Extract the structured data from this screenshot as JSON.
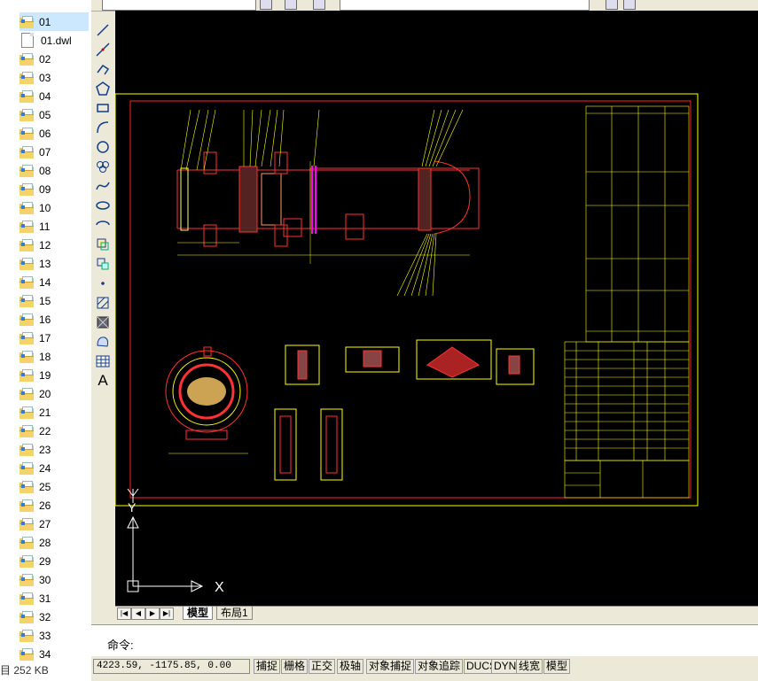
{
  "explorer": {
    "items": [
      {
        "label": "01",
        "type": "folder",
        "selected": true
      },
      {
        "label": "01.dwl",
        "type": "file"
      },
      {
        "label": "02",
        "type": "folder"
      },
      {
        "label": "03",
        "type": "folder"
      },
      {
        "label": "04",
        "type": "folder"
      },
      {
        "label": "05",
        "type": "folder"
      },
      {
        "label": "06",
        "type": "folder"
      },
      {
        "label": "07",
        "type": "folder"
      },
      {
        "label": "08",
        "type": "folder"
      },
      {
        "label": "09",
        "type": "folder"
      },
      {
        "label": "10",
        "type": "folder"
      },
      {
        "label": "11",
        "type": "folder"
      },
      {
        "label": "12",
        "type": "folder"
      },
      {
        "label": "13",
        "type": "folder"
      },
      {
        "label": "14",
        "type": "folder"
      },
      {
        "label": "15",
        "type": "folder"
      },
      {
        "label": "16",
        "type": "folder"
      },
      {
        "label": "17",
        "type": "folder"
      },
      {
        "label": "18",
        "type": "folder"
      },
      {
        "label": "19",
        "type": "folder"
      },
      {
        "label": "20",
        "type": "folder"
      },
      {
        "label": "21",
        "type": "folder"
      },
      {
        "label": "22",
        "type": "folder"
      },
      {
        "label": "23",
        "type": "folder"
      },
      {
        "label": "24",
        "type": "folder"
      },
      {
        "label": "25",
        "type": "folder"
      },
      {
        "label": "26",
        "type": "folder"
      },
      {
        "label": "27",
        "type": "folder"
      },
      {
        "label": "28",
        "type": "folder"
      },
      {
        "label": "29",
        "type": "folder"
      },
      {
        "label": "30",
        "type": "folder"
      },
      {
        "label": "31",
        "type": "folder"
      },
      {
        "label": "32",
        "type": "folder"
      },
      {
        "label": "33",
        "type": "folder"
      },
      {
        "label": "34",
        "type": "folder"
      }
    ],
    "status_size": "252 KB"
  },
  "cad": {
    "tabs": [
      "模型",
      "布局1"
    ],
    "active_tab": "模型",
    "command_prompt": "命令:",
    "coordinates": "4223.59, -1175.85, 0.00",
    "status_buttons": [
      "捕捉",
      "栅格",
      "正交",
      "极轴",
      "对象捕捉",
      "对象追踪",
      "DUCS",
      "DYN",
      "线宽",
      "模型"
    ],
    "ucs_x": "X",
    "ucs_y": "Y",
    "text_tool": "A",
    "colors": {
      "canvas": "#000000",
      "frame": "#ffff00",
      "drawing": "#ff0000",
      "accent": "#ff00ff"
    }
  }
}
